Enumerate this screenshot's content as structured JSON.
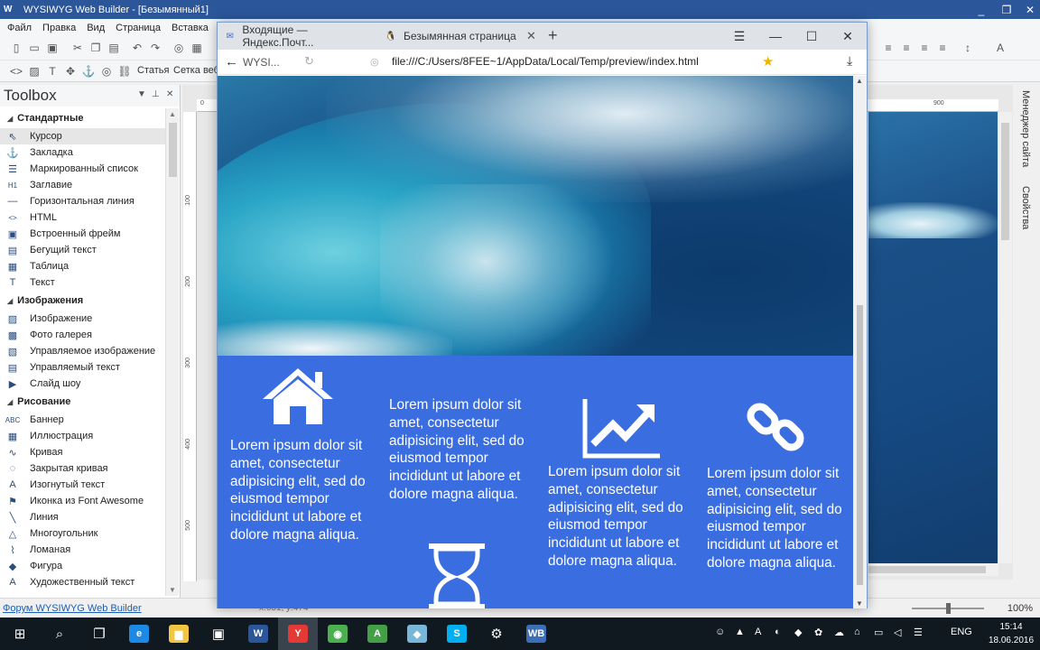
{
  "app": {
    "title": "WYSIWYG Web Builder - [Безымянный1]",
    "logo": "W",
    "window_controls": [
      "_",
      "❐",
      "✕"
    ]
  },
  "menu": [
    "Файл",
    "Правка",
    "Вид",
    "Страница",
    "Вставка"
  ],
  "toolbar2_labels": [
    "Статья",
    "Сетка веб"
  ],
  "toolbox": {
    "title": "Toolbox",
    "categories": [
      {
        "name": "Стандартные",
        "items": [
          {
            "label": "Курсор",
            "icon": "cursor-icon",
            "glyph": "⇖",
            "selected": true
          },
          {
            "label": "Закладка",
            "icon": "anchor-icon",
            "glyph": "⚓"
          },
          {
            "label": "Маркированный список",
            "icon": "list-icon",
            "glyph": "☰"
          },
          {
            "label": "Заглавие",
            "icon": "heading-icon",
            "glyph": "H1"
          },
          {
            "label": "Горизонтальная линия",
            "icon": "hr-icon",
            "glyph": "—"
          },
          {
            "label": "HTML",
            "icon": "code-icon",
            "glyph": "<>"
          },
          {
            "label": "Встроенный фрейм",
            "icon": "iframe-icon",
            "glyph": "▣"
          },
          {
            "label": "Бегущий текст",
            "icon": "marquee-icon",
            "glyph": "▤"
          },
          {
            "label": "Таблица",
            "icon": "table-icon",
            "glyph": "▦"
          },
          {
            "label": "Текст",
            "icon": "text-icon",
            "glyph": "T"
          }
        ]
      },
      {
        "name": "Изображения",
        "items": [
          {
            "label": "Изображение",
            "icon": "image-icon",
            "glyph": "▨"
          },
          {
            "label": "Фото галерея",
            "icon": "gallery-icon",
            "glyph": "▩"
          },
          {
            "label": "Управляемое изображение",
            "icon": "managed-image-icon",
            "glyph": "▧"
          },
          {
            "label": "Управляемый текст",
            "icon": "managed-text-icon",
            "glyph": "▤"
          },
          {
            "label": "Слайд шоу",
            "icon": "slideshow-icon",
            "glyph": "▶"
          }
        ]
      },
      {
        "name": "Рисование",
        "items": [
          {
            "label": "Баннер",
            "icon": "banner-icon",
            "glyph": "ABC"
          },
          {
            "label": "Иллюстрация",
            "icon": "illustration-icon",
            "glyph": "▦"
          },
          {
            "label": "Кривая",
            "icon": "curve-icon",
            "glyph": "∿"
          },
          {
            "label": "Закрытая кривая",
            "icon": "closed-curve-icon",
            "glyph": "◌"
          },
          {
            "label": "Изогнутый текст",
            "icon": "curved-text-icon",
            "glyph": "A"
          },
          {
            "label": "Иконка из Font Awesome",
            "icon": "flag-icon",
            "glyph": "⚑"
          },
          {
            "label": "Линия",
            "icon": "line-icon",
            "glyph": "╲"
          },
          {
            "label": "Многоугольник",
            "icon": "polygon-icon",
            "glyph": "△"
          },
          {
            "label": "Ломаная",
            "icon": "polyline-icon",
            "glyph": "⌇"
          },
          {
            "label": "Фигура",
            "icon": "shape-icon",
            "glyph": "◆"
          },
          {
            "label": "Художественный текст",
            "icon": "art-text-icon",
            "glyph": "A"
          }
        ]
      }
    ]
  },
  "ruler": {
    "top_ticks": [
      "0",
      "900"
    ],
    "left_ticks": [
      "100",
      "200",
      "300",
      "400",
      "500"
    ]
  },
  "right_panel": {
    "tabs": [
      "Менеджер сайта",
      "Свойства"
    ]
  },
  "status": {
    "forum_link": "Форум WYSIWYG Web Builder",
    "coords": "x:651, y:474",
    "zoom": "100%"
  },
  "browser": {
    "tabs": [
      {
        "label": "Входящие — Яндекс.Почт...",
        "icon": "mail-icon",
        "glyph": "✉"
      },
      {
        "label": "Безымянная страница",
        "icon": "penguin-icon",
        "glyph": "🐧"
      }
    ],
    "new_tab": "+",
    "controls": [
      "☰",
      "—",
      "☐",
      "✕"
    ],
    "site_tab": "WYSI...",
    "url": "file:///C:/Users/8FEE~1/AppData/Local/Temp/preview/index.html",
    "page": {
      "background_color": "#3a6de0",
      "features": [
        {
          "icon": "home-icon",
          "text": "Lorem ipsum dolor sit amet, consectetur adipisicing elit, sed do eiusmod tempor incididunt ut labore et dolore magna aliqua."
        },
        {
          "icon": "hourglass-icon",
          "text": "Lorem ipsum dolor sit amet, consectetur adipisicing elit, sed do eiusmod tempor incididunt ut labore et dolore magna aliqua."
        },
        {
          "icon": "chart-line-icon",
          "text": "Lorem ipsum dolor sit amet, consectetur adipisicing elit, sed do eiusmod tempor incididunt ut labore et dolore magna aliqua."
        },
        {
          "icon": "link-icon",
          "text": "Lorem ipsum dolor sit amet, consectetur adipisicing elit, sed do eiusmod tempor incididunt ut labore et dolore magna aliqua."
        }
      ]
    }
  },
  "taskbar": {
    "apps": [
      {
        "name": "start-icon",
        "glyph": "⊞"
      },
      {
        "name": "search-icon",
        "glyph": "⌕"
      },
      {
        "name": "task-view-icon",
        "glyph": "❐"
      },
      {
        "name": "edge-icon",
        "glyph": "e"
      },
      {
        "name": "explorer-icon",
        "glyph": "▆"
      },
      {
        "name": "store-icon",
        "glyph": "▣"
      },
      {
        "name": "word-icon",
        "glyph": "W"
      },
      {
        "name": "yandex-icon",
        "glyph": "Y"
      },
      {
        "name": "chrome-icon",
        "glyph": "◉"
      },
      {
        "name": "app-a-icon",
        "glyph": "A"
      },
      {
        "name": "app-tile-icon",
        "glyph": "◆"
      },
      {
        "name": "skype-icon",
        "glyph": "S"
      },
      {
        "name": "app-gear-icon",
        "glyph": "⚙"
      },
      {
        "name": "wysiwyg-icon",
        "glyph": "WB"
      }
    ],
    "lang": "ENG",
    "time": "15:14",
    "date": "18.06.2016"
  }
}
